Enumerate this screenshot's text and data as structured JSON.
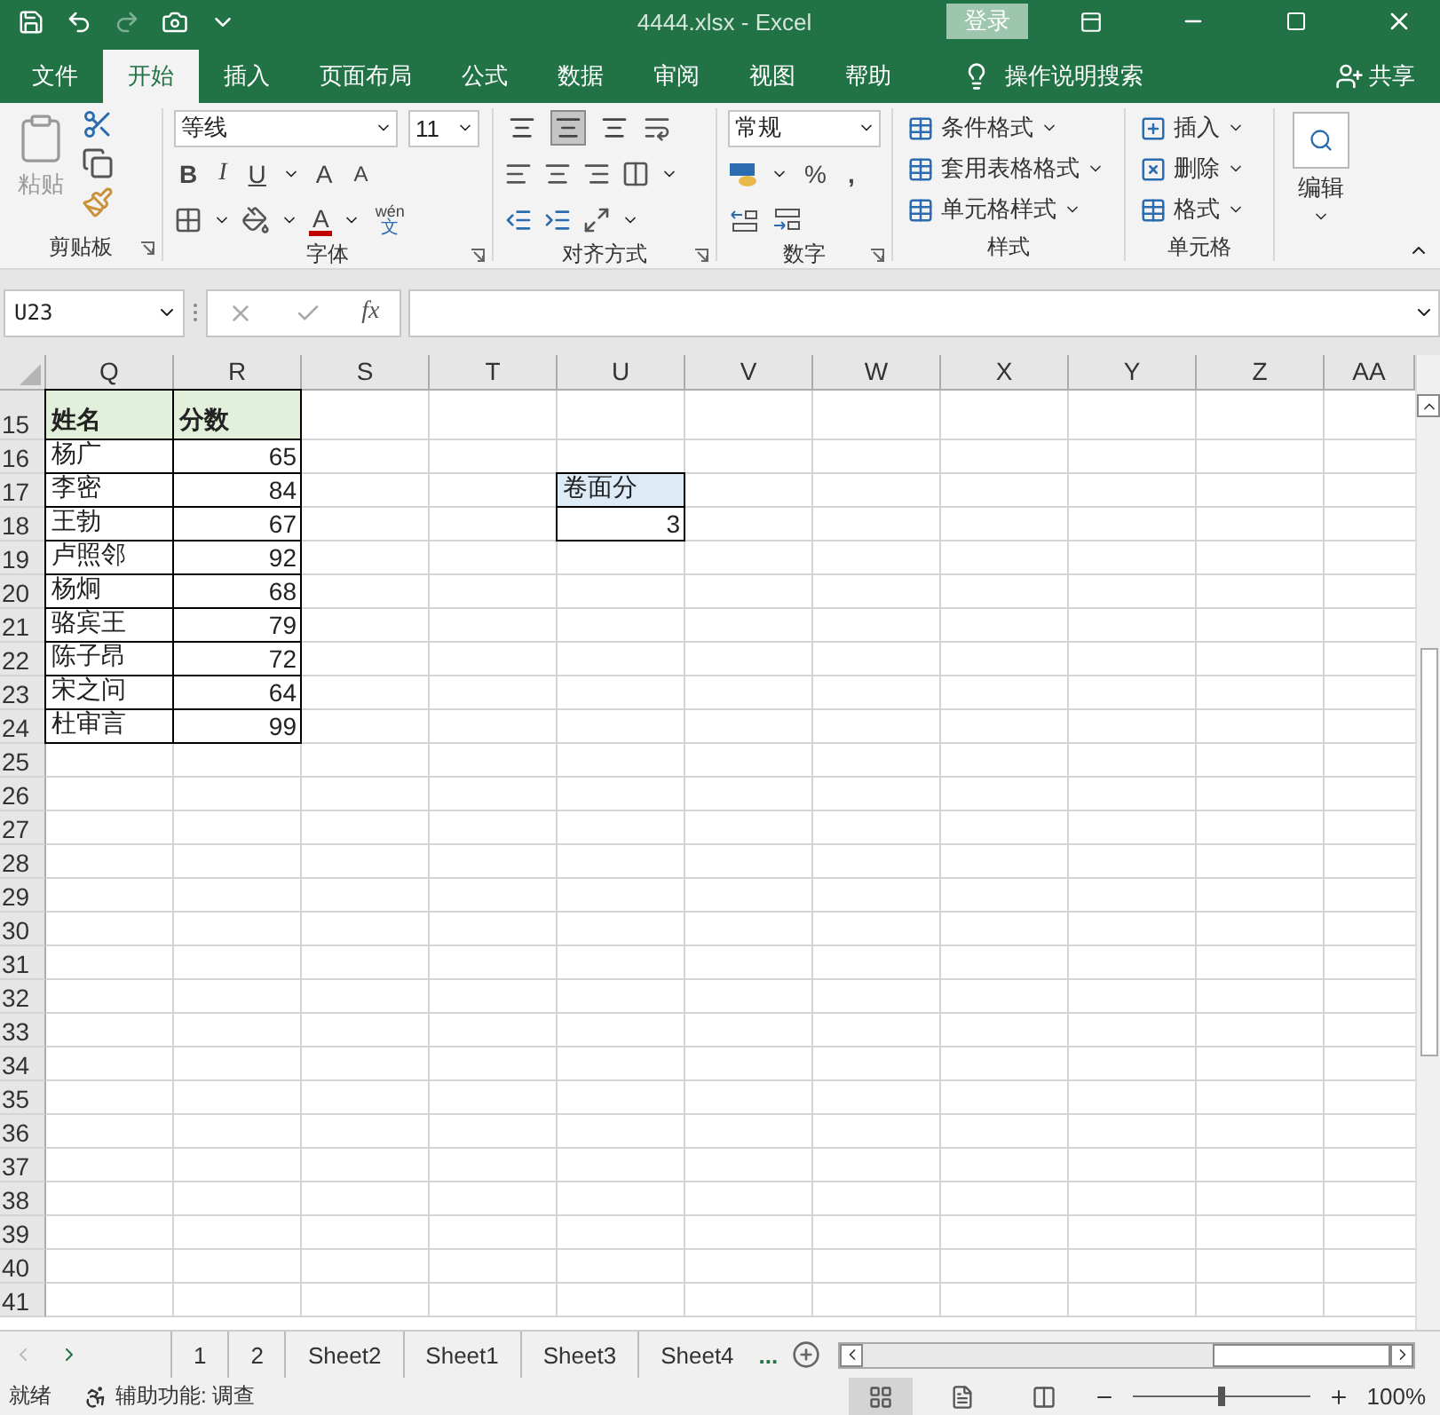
{
  "title_bar": {
    "title": "4444.xlsx  -  Excel",
    "sign_in": "登录",
    "quick_access": [
      {
        "kind": "save",
        "disabled": false
      },
      {
        "kind": "undo",
        "disabled": false
      },
      {
        "kind": "redo",
        "disabled": true
      },
      {
        "kind": "camera",
        "disabled": false
      },
      {
        "kind": "customize",
        "disabled": false
      }
    ]
  },
  "ribbon_tabs": [
    {
      "label": "文件",
      "selected": false
    },
    {
      "label": "开始",
      "selected": true
    },
    {
      "label": "插入",
      "selected": false
    },
    {
      "label": "页面布局",
      "selected": false
    },
    {
      "label": "公式",
      "selected": false
    },
    {
      "label": "数据",
      "selected": false
    },
    {
      "label": "审阅",
      "selected": false
    },
    {
      "label": "视图",
      "selected": false
    },
    {
      "label": "帮助",
      "selected": false
    }
  ],
  "tell_me": "操作说明搜索",
  "share": "共享",
  "ribbon_groups": [
    {
      "kind": "clipboard",
      "label": "剪贴板",
      "paste": "粘贴",
      "paste_disabled": true
    },
    {
      "kind": "font",
      "label": "字体",
      "font": "等线",
      "size": "11",
      "bold": "B",
      "italic": "I",
      "underline": "U",
      "grow": "A",
      "shrink": "A",
      "font_color": "A",
      "phonetic_top": "wén",
      "phonetic_bottom": "文"
    },
    {
      "kind": "alignment",
      "label": "对齐方式",
      "vertical_align": [
        {
          "selected": false
        },
        {
          "selected": true
        },
        {
          "selected": false
        }
      ]
    },
    {
      "kind": "number",
      "label": "数字",
      "format": "常规",
      "percent": "%",
      "comma": ","
    },
    {
      "kind": "styles",
      "label": "样式",
      "commands": [
        "条件格式",
        "套用表格格式",
        "单元格样式"
      ]
    },
    {
      "kind": "cells",
      "label": "单元格",
      "commands": [
        "插入",
        "删除",
        "格式"
      ]
    },
    {
      "kind": "editing",
      "label": "编辑"
    }
  ],
  "formula_bar": {
    "name_box": "U23",
    "fx": "fx"
  },
  "sheet": {
    "columns": [
      "Q",
      "R",
      "S",
      "T",
      "U",
      "V",
      "W",
      "X",
      "Y",
      "Z",
      "AA"
    ],
    "rows": [
      {
        "header": "15",
        "tall": true,
        "cells": [
          {
            "text": "姓名",
            "kind": "header"
          },
          {
            "text": "分数",
            "kind": "header"
          }
        ]
      },
      {
        "header": "16",
        "tall": false,
        "cells": [
          {
            "text": "杨广",
            "kind": "text"
          },
          {
            "text": "65",
            "kind": "number"
          }
        ]
      },
      {
        "header": "17",
        "tall": false,
        "cells": [
          {
            "text": "李密",
            "kind": "text"
          },
          {
            "text": "84",
            "kind": "number"
          },
          {
            "kind": "empty"
          },
          {
            "kind": "empty"
          },
          {
            "text": "卷面分",
            "kind": "label"
          }
        ]
      },
      {
        "header": "18",
        "tall": false,
        "cells": [
          {
            "text": "王勃",
            "kind": "text"
          },
          {
            "text": "67",
            "kind": "number"
          },
          {
            "kind": "empty"
          },
          {
            "kind": "empty"
          },
          {
            "text": "3",
            "kind": "number"
          }
        ]
      },
      {
        "header": "19",
        "tall": false,
        "cells": [
          {
            "text": "卢照邻",
            "kind": "text"
          },
          {
            "text": "92",
            "kind": "number"
          }
        ]
      },
      {
        "header": "20",
        "tall": false,
        "cells": [
          {
            "text": "杨炯",
            "kind": "text"
          },
          {
            "text": "68",
            "kind": "number"
          }
        ]
      },
      {
        "header": "21",
        "tall": false,
        "cells": [
          {
            "text": "骆宾王",
            "kind": "text"
          },
          {
            "text": "79",
            "kind": "number"
          }
        ]
      },
      {
        "header": "22",
        "tall": false,
        "cells": [
          {
            "text": "陈子昂",
            "kind": "text"
          },
          {
            "text": "72",
            "kind": "number"
          }
        ]
      },
      {
        "header": "23",
        "tall": false,
        "cells": [
          {
            "text": "宋之问",
            "kind": "text"
          },
          {
            "text": "64",
            "kind": "number"
          }
        ]
      },
      {
        "header": "24",
        "tall": false,
        "cells": [
          {
            "text": "杜审言",
            "kind": "text"
          },
          {
            "text": "99",
            "kind": "number"
          }
        ]
      },
      {
        "header": "25",
        "tall": false,
        "cells": []
      },
      {
        "header": "26",
        "tall": false,
        "cells": []
      },
      {
        "header": "27",
        "tall": false,
        "cells": []
      },
      {
        "header": "28",
        "tall": false,
        "cells": []
      },
      {
        "header": "29",
        "tall": false,
        "cells": []
      },
      {
        "header": "30",
        "tall": false,
        "cells": []
      },
      {
        "header": "31",
        "tall": false,
        "cells": []
      },
      {
        "header": "32",
        "tall": false,
        "cells": []
      },
      {
        "header": "33",
        "tall": false,
        "cells": []
      },
      {
        "header": "34",
        "tall": false,
        "cells": []
      },
      {
        "header": "35",
        "tall": false,
        "cells": []
      },
      {
        "header": "36",
        "tall": false,
        "cells": []
      },
      {
        "header": "37",
        "tall": false,
        "cells": []
      },
      {
        "header": "38",
        "tall": false,
        "cells": []
      },
      {
        "header": "39",
        "tall": false,
        "cells": []
      },
      {
        "header": "40",
        "tall": false,
        "cells": []
      },
      {
        "header": "41",
        "tall": false,
        "cells": []
      }
    ]
  },
  "sheet_tabs": [
    {
      "label": "1",
      "selected": false
    },
    {
      "label": "2",
      "selected": false
    },
    {
      "label": "Sheet2",
      "selected": false
    },
    {
      "label": "Sheet1",
      "selected": false
    },
    {
      "label": "Sheet3",
      "selected": false
    },
    {
      "label": "Sheet4",
      "selected": false
    }
  ],
  "more_tabs": "...",
  "status_bar": {
    "ready": "就绪",
    "accessibility": "辅助功能: 调查",
    "views": [
      {
        "kind": "normal",
        "selected": true
      },
      {
        "kind": "page_layout",
        "selected": false
      },
      {
        "kind": "page_break",
        "selected": false
      }
    ],
    "zoom_slider": {
      "level": 0.5
    },
    "zoom": "100%"
  }
}
